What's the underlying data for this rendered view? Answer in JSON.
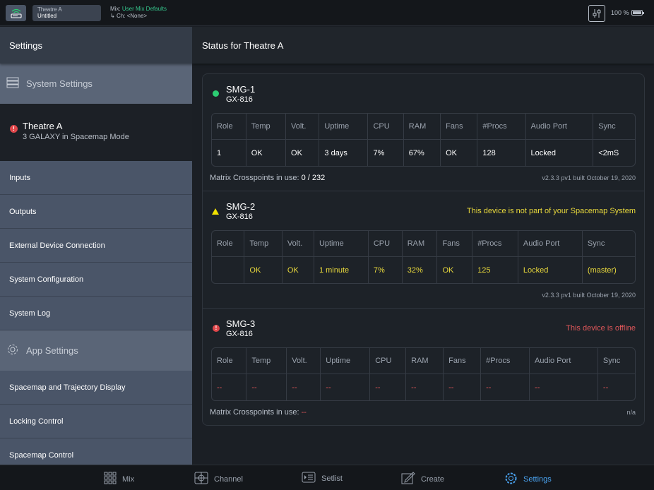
{
  "topbar": {
    "app_icon": "wifi-device-icon",
    "show_line1": "Theatre A",
    "show_line2": "Untitled",
    "mix_prefix": "Mix:",
    "mix_name": "User Mix Defaults",
    "channel_line": "Ch: <None>",
    "mixer_icon": "sliders-icon",
    "battery_text": "100 %",
    "battery_level": 1.0
  },
  "sidebar": {
    "header": "Settings",
    "system_settings_label": "System Settings",
    "device_name": "Theatre A",
    "device_sub": "3 GALAXY in Spacemap Mode",
    "items_system": [
      "Inputs",
      "Outputs",
      "External Device Connection",
      "System Configuration",
      "System Log"
    ],
    "app_settings_label": "App Settings",
    "items_app": [
      "Spacemap and Trajectory Display",
      "Locking Control",
      "Spacemap Control"
    ]
  },
  "main": {
    "title": "Status for Theatre A",
    "columns": [
      "Role",
      "Temp",
      "Volt.",
      "Uptime",
      "CPU",
      "RAM",
      "Fans",
      "#Procs",
      "Audio Port",
      "Sync"
    ],
    "devices": [
      {
        "name": "SMG-1",
        "model": "GX-816",
        "status": "ok",
        "message": "",
        "row": [
          "1",
          "OK",
          "OK",
          "3 days",
          "7%",
          "67%",
          "OK",
          "128",
          "Locked",
          "<2mS"
        ],
        "crosspoints_label": "Matrix Crosspoints in use:",
        "crosspoints_value": "0 / 232",
        "build": "v2.3.3 pv1 built October 19, 2020"
      },
      {
        "name": "SMG-2",
        "model": "GX-816",
        "status": "warning",
        "message": "This device is not part of your Spacemap System",
        "row": [
          "",
          "OK",
          "OK",
          "1 minute",
          "7%",
          "32%",
          "OK",
          "125",
          "Locked",
          "(master)"
        ],
        "crosspoints_label": "",
        "crosspoints_value": "",
        "build": "v2.3.3 pv1 built October 19, 2020"
      },
      {
        "name": "SMG-3",
        "model": "GX-816",
        "status": "offline",
        "message": "This device is offline",
        "row": [
          "--",
          "--",
          "--",
          "--",
          "--",
          "--",
          "--",
          "--",
          "--",
          "--"
        ],
        "crosspoints_label": "Matrix Crosspoints in use:",
        "crosspoints_value": "--",
        "build": "n/a"
      }
    ]
  },
  "bottomnav": {
    "items": [
      {
        "label": "Mix",
        "icon": "grid-icon"
      },
      {
        "label": "Channel",
        "icon": "crosshair-icon"
      },
      {
        "label": "Setlist",
        "icon": "list-play-icon"
      },
      {
        "label": "Create",
        "icon": "edit-icon"
      },
      {
        "label": "Settings",
        "icon": "gear-icon"
      }
    ],
    "active": "Settings"
  },
  "colors": {
    "accent": "#4aa3f0",
    "ok_green": "#2ccd73",
    "warning_yellow": "#e8d83c",
    "error_red": "#e0575a",
    "mix_green": "#35c28a"
  }
}
